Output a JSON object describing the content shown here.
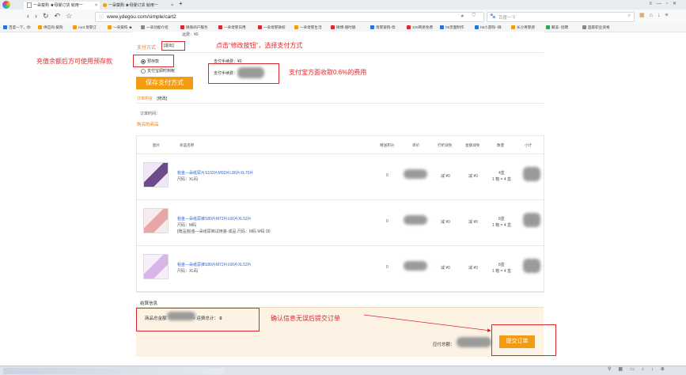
{
  "browser": {
    "tabs": [
      {
        "label": "一朵葵购 ★母婴订货 就用一"
      },
      {
        "label": "一朵葵购 ★母婴订货 就用一"
      }
    ],
    "new_tab": "+",
    "url": "www.ydegou.com/simple/cart2",
    "search_placeholder": "百度一下",
    "window_controls": [
      "—",
      "▫",
      "✕"
    ],
    "bookmarks": [
      {
        "label": "百度一下，你",
        "color": "#2f6fd6"
      },
      {
        "label": "供应商-葵购",
        "color": "#f39c12"
      },
      {
        "label": "root 母婴订",
        "color": "#f39c12"
      },
      {
        "label": "一朵葵购 ★",
        "color": "#f39c12"
      },
      {
        "label": "一朵功能介绍",
        "color": "#888888"
      },
      {
        "label": "微微商户服务",
        "color": "#d9282f"
      },
      {
        "label": "一朵母婴日用",
        "color": "#d9282f"
      },
      {
        "label": "一朵母婴微权",
        "color": "#d9282f"
      },
      {
        "label": "一朵母婴生活",
        "color": "#f39c12"
      },
      {
        "label": "微博-随时随",
        "color": "#d9282f"
      },
      {
        "label": "母婴葵购-母",
        "color": "#2f6fd6"
      },
      {
        "label": "126网易免费",
        "color": "#d9282f"
      },
      {
        "label": "h5页面制作",
        "color": "#2f6fd6"
      },
      {
        "label": "h5小游戏--微",
        "color": "#2f6fd6"
      },
      {
        "label": "长沙胃婴感",
        "color": "#f39c12"
      },
      {
        "label": "聚美- 招聘",
        "color": "#2fa84f"
      },
      {
        "label": "国家职业资格",
        "color": "#888888"
      }
    ]
  },
  "top_partial": "运费：¥0",
  "payment": {
    "section_label": "支付方式",
    "modify_label": "[退出]",
    "options": [
      "预存款",
      "支付宝即时到帐"
    ],
    "fee_label_1": "支付手续费：¥0",
    "fee_label_2": "支付手续费：",
    "save_button": "保存支付方式"
  },
  "order_note": {
    "label": "订单附言",
    "modify": "[修改]",
    "time_label": "订单时间："
  },
  "products_section": {
    "title": "购买的商品",
    "headers": [
      "图片",
      "商品名称",
      "赠送积分",
      "单价",
      "打折减免",
      "金额减免",
      "数量",
      "小计"
    ],
    "rows": [
      {
        "name": "帕金—朵纸尿片S102片M92片L86片XL70片",
        "spec": "尺码：XL码",
        "extra": "",
        "points": "0",
        "discount": "减 ¥0",
        "amount_discount": "减 ¥0",
        "qty": "4盒",
        "qty_detail": "1 箱 = 4 盒"
      },
      {
        "name": "帕金—朵纸尿裤S80片M72片L60片XL52片",
        "spec": "尺码：M码",
        "extra": "[赠品]帕金—朵纸尿裤试用装-成品 尺码：M码 M码  00",
        "points": "0",
        "discount": "减 ¥0",
        "amount_discount": "减 ¥0",
        "qty": "8盒",
        "qty_detail": "1 箱 = 4 盒"
      },
      {
        "name": "帕金—朵纸尿裤S80片M72片L60片XL52片",
        "spec": "尺码：XL码",
        "extra": "",
        "points": "0",
        "discount": "减 ¥0",
        "amount_discount": "减 ¥0",
        "qty": "8盒",
        "qty_detail": "1 箱 = 4 盒"
      }
    ]
  },
  "settlement": {
    "title": "结算信息",
    "goods_total_label": "商品总金额",
    "plus": "+",
    "shipping_label": "运费总计：",
    "shipping_value": "0",
    "payable_label": "应付总额：",
    "submit_button": "提交订单"
  },
  "annotations": {
    "modify_hint": "点击“修改按钮”，选择支付方式",
    "prepaid_hint": "充值余额后方可使用预存款",
    "alipay_hint": "支付宝方面收取0.6%的费用",
    "confirm_hint": "确认信息无误后提交订单"
  },
  "colors": {
    "accent_orange": "#f39c12",
    "annotation_red": "#e4262b",
    "settlement_bg": "#fdf3e4"
  },
  "status_icons": [
    "pin-icon",
    "grid-icon",
    "window-icon",
    "volume-icon",
    "download-icon",
    "zoom-icon"
  ]
}
